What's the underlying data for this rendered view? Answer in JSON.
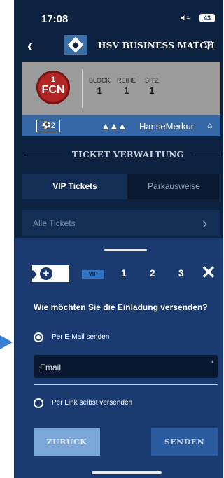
{
  "status_bar": {
    "time": "17:08",
    "signal": "•ıl ≈",
    "battery": "43"
  },
  "header": {
    "title": "HSV BUSINESS MATCH"
  },
  "ticket": {
    "club": {
      "top": "1",
      "bottom": "FCN"
    },
    "block_label": "BLOCK",
    "block_value": "1",
    "row_label": "REIHE",
    "row_value": "1",
    "seat_label": "SITZ",
    "seat_value": "1",
    "sponsors": {
      "league": "⚽2",
      "brand_mark": "▲▲▲",
      "insurer": "HanseMerkur",
      "insurer_icon": "⌂"
    }
  },
  "section_title": "TICKET VERWALTUNG",
  "tabs": [
    {
      "label": "VIP Tickets"
    },
    {
      "label": "Parkausweise"
    }
  ],
  "filter": {
    "label": "Alle Tickets"
  },
  "sheet": {
    "stepper": {
      "plus": "+",
      "vip": "VIP",
      "steps": [
        "1",
        "2",
        "3"
      ],
      "close": "✕"
    },
    "question": "Wie möchten Sie die Einladung versenden?",
    "option_email": "Per E-Mail senden",
    "email_placeholder": "Email",
    "required_mark": "*",
    "option_link": "Per Link selbst versenden",
    "back_label": "ZURÜCK",
    "send_label": "SENDEN"
  },
  "colors": {
    "background": "#0d2240",
    "sheet": "#1b3b70",
    "accent": "#3566a6"
  }
}
